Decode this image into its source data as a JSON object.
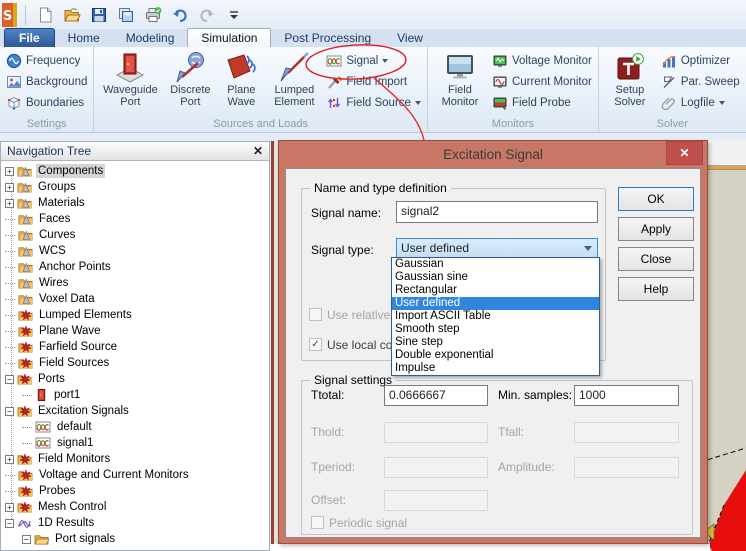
{
  "qat": {
    "icons": [
      {
        "name": "cst-logo-icon"
      },
      {
        "name": "new-document-icon"
      },
      {
        "name": "open-icon"
      },
      {
        "name": "save-icon"
      },
      {
        "name": "copy-icon"
      },
      {
        "name": "print-icon"
      },
      {
        "name": "undo-icon"
      },
      {
        "name": "redo-icon"
      },
      {
        "name": "customize-toolbar-icon"
      }
    ]
  },
  "tabs": [
    {
      "label": "File",
      "style": "file"
    },
    {
      "label": "Home"
    },
    {
      "label": "Modeling"
    },
    {
      "label": "Simulation",
      "active": true
    },
    {
      "label": "Post Processing"
    },
    {
      "label": "View"
    }
  ],
  "ribbon": {
    "groups": [
      {
        "label": "Settings",
        "width": 100,
        "stack": [
          {
            "label": "Frequency",
            "icon": "frequency"
          },
          {
            "label": "Background",
            "icon": "background"
          },
          {
            "label": "Boundaries",
            "icon": "boundaries"
          }
        ]
      },
      {
        "label": "Sources and Loads",
        "big": [
          {
            "label": "Waveguide\nPort",
            "icon": "waveguide-port",
            "w": 64
          },
          {
            "label": "Discrete\nPort",
            "icon": "discrete-port",
            "w": 52
          },
          {
            "label": "Plane\nWave",
            "icon": "plane-wave",
            "w": 46
          },
          {
            "label": "Lumped\nElement",
            "icon": "lumped-element",
            "w": 56
          }
        ],
        "stack": [
          {
            "label": "Signal",
            "icon": "signal",
            "dropdown": true
          },
          {
            "label": "Field Import",
            "icon": "field-import"
          },
          {
            "label": "Field Source",
            "icon": "field-source",
            "dropdown": true
          }
        ]
      },
      {
        "label": "Monitors",
        "big": [
          {
            "label": "Field\nMonitor",
            "icon": "field-monitor",
            "w": 56
          }
        ],
        "stack": [
          {
            "label": "Voltage Monitor",
            "icon": "voltage-monitor"
          },
          {
            "label": "Current Monitor",
            "icon": "current-monitor"
          },
          {
            "label": "Field Probe",
            "icon": "field-probe"
          }
        ]
      },
      {
        "label": "Solver",
        "big": [
          {
            "label": "Setup\nSolver",
            "icon": "setup-solver",
            "w": 54
          }
        ],
        "stack": [
          {
            "label": "Optimizer",
            "icon": "optimizer"
          },
          {
            "label": "Par. Sweep",
            "icon": "par-sweep"
          },
          {
            "label": "Logfile",
            "icon": "logfile",
            "dropdown": true
          }
        ]
      }
    ]
  },
  "nav": {
    "title": "Navigation Tree",
    "close_icon": "close-icon",
    "items": [
      {
        "label": "Components",
        "icon": "folder-cone",
        "expander": "plus",
        "level": 0,
        "selected": true
      },
      {
        "label": "Groups",
        "icon": "folder-cone",
        "expander": "plus",
        "level": 0
      },
      {
        "label": "Materials",
        "icon": "folder-cone",
        "expander": "plus",
        "level": 0
      },
      {
        "label": "Faces",
        "icon": "folder-cone",
        "level": 0
      },
      {
        "label": "Curves",
        "icon": "folder-cone",
        "level": 0
      },
      {
        "label": "WCS",
        "icon": "folder-cone",
        "level": 0
      },
      {
        "label": "Anchor Points",
        "icon": "folder-cone",
        "level": 0
      },
      {
        "label": "Wires",
        "icon": "folder-cone",
        "level": 0
      },
      {
        "label": "Voxel Data",
        "icon": "folder-cone",
        "level": 0
      },
      {
        "label": "Lumped Elements",
        "icon": "folder-star",
        "level": 0
      },
      {
        "label": "Plane Wave",
        "icon": "folder-star",
        "level": 0
      },
      {
        "label": "Farfield Source",
        "icon": "folder-star",
        "level": 0
      },
      {
        "label": "Field Sources",
        "icon": "folder-star",
        "level": 0
      },
      {
        "label": "Ports",
        "icon": "folder-star",
        "expander": "minus",
        "level": 0
      },
      {
        "label": "port1",
        "icon": "door",
        "level": 1
      },
      {
        "label": "Excitation Signals",
        "icon": "folder-star",
        "expander": "minus",
        "level": 0
      },
      {
        "label": "default",
        "icon": "signal",
        "level": 1
      },
      {
        "label": "signal1",
        "icon": "signal",
        "level": 1
      },
      {
        "label": "Field Monitors",
        "icon": "folder-star",
        "expander": "plus",
        "level": 0
      },
      {
        "label": "Voltage and Current Monitors",
        "icon": "folder-star",
        "level": 0
      },
      {
        "label": "Probes",
        "icon": "folder-star",
        "level": 0
      },
      {
        "label": "Mesh Control",
        "icon": "folder-star",
        "expander": "plus",
        "level": 0
      },
      {
        "label": "1D Results",
        "icon": "curves",
        "expander": "minus",
        "level": 0
      },
      {
        "label": "Port signals",
        "icon": "folder",
        "expander": "minus",
        "level": 1
      }
    ]
  },
  "dialog": {
    "title": "Excitation Signal",
    "close_icon": "close-icon",
    "name_group_label": "Name and type definition",
    "signal_name_label": "Signal name:",
    "signal_name_value": "signal2",
    "signal_type_label": "Signal type:",
    "signal_type_value": "User defined",
    "use_relative_label": "Use relative pa",
    "use_local_label": "Use local copy",
    "dropdown": {
      "items": [
        "Gaussian",
        "Gaussian sine",
        "Rectangular",
        "User defined",
        "Import ASCII Table",
        "Smooth step",
        "Sine step",
        "Double exponential",
        "Impulse"
      ],
      "selected": "User defined"
    },
    "settings_group_label": "Signal settings",
    "settings_fields": [
      {
        "label": "Ttotal:",
        "value": "0.0666667",
        "enabled": true,
        "row": 0,
        "col": 0
      },
      {
        "label": "Min. samples:",
        "value": "1000",
        "enabled": true,
        "row": 0,
        "col": 1
      },
      {
        "label": "Thold:",
        "value": "",
        "enabled": false,
        "row": 1,
        "col": 0
      },
      {
        "label": "Tfall:",
        "value": "",
        "enabled": false,
        "row": 1,
        "col": 1
      },
      {
        "label": "Tperiod:",
        "value": "",
        "enabled": false,
        "row": 2,
        "col": 0
      },
      {
        "label": "Amplitude:",
        "value": "",
        "enabled": false,
        "row": 2,
        "col": 1
      },
      {
        "label": "Offset:",
        "value": "",
        "enabled": false,
        "row": 3,
        "col": 0
      }
    ],
    "periodic_label": "Periodic signal",
    "buttons": [
      "OK",
      "Apply",
      "Close",
      "Help"
    ]
  },
  "annotation_color": "#e02020"
}
